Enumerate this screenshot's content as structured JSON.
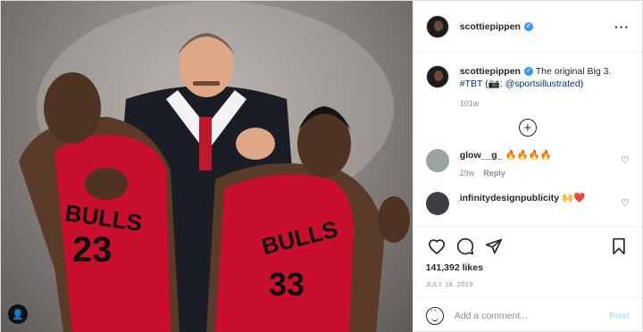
{
  "photo": {
    "alt": "",
    "user_tag_icon": "person-icon"
  },
  "header": {
    "username": "scottiepippen",
    "verified_icon": "verified-badge-icon",
    "more_icon": "more-options-icon",
    "more_glyph": "···"
  },
  "caption": {
    "username": "scottiepippen",
    "text": "The original Big 3.",
    "hashtag": "#TBT",
    "camera": "(📷:",
    "mention": "@sportsillustrated",
    "close": ")",
    "time": "101w"
  },
  "load_more_glyph": "+",
  "comments": [
    {
      "username": "glow__g_",
      "text": "🔥🔥🔥🔥",
      "time": "29w",
      "reply": "Reply"
    },
    {
      "username": "infinitydesignpublicity",
      "text": "🙌❤️"
    }
  ],
  "likes": "141,392 likes",
  "date": "JULY 18, 2019",
  "add_comment": {
    "placeholder": "Add a comment...",
    "post_label": "Post"
  },
  "colors": {
    "verified": "#3897f0",
    "link": "#00376b",
    "muted": "#8e8e8e",
    "post_disabled": "#b2dffc"
  }
}
